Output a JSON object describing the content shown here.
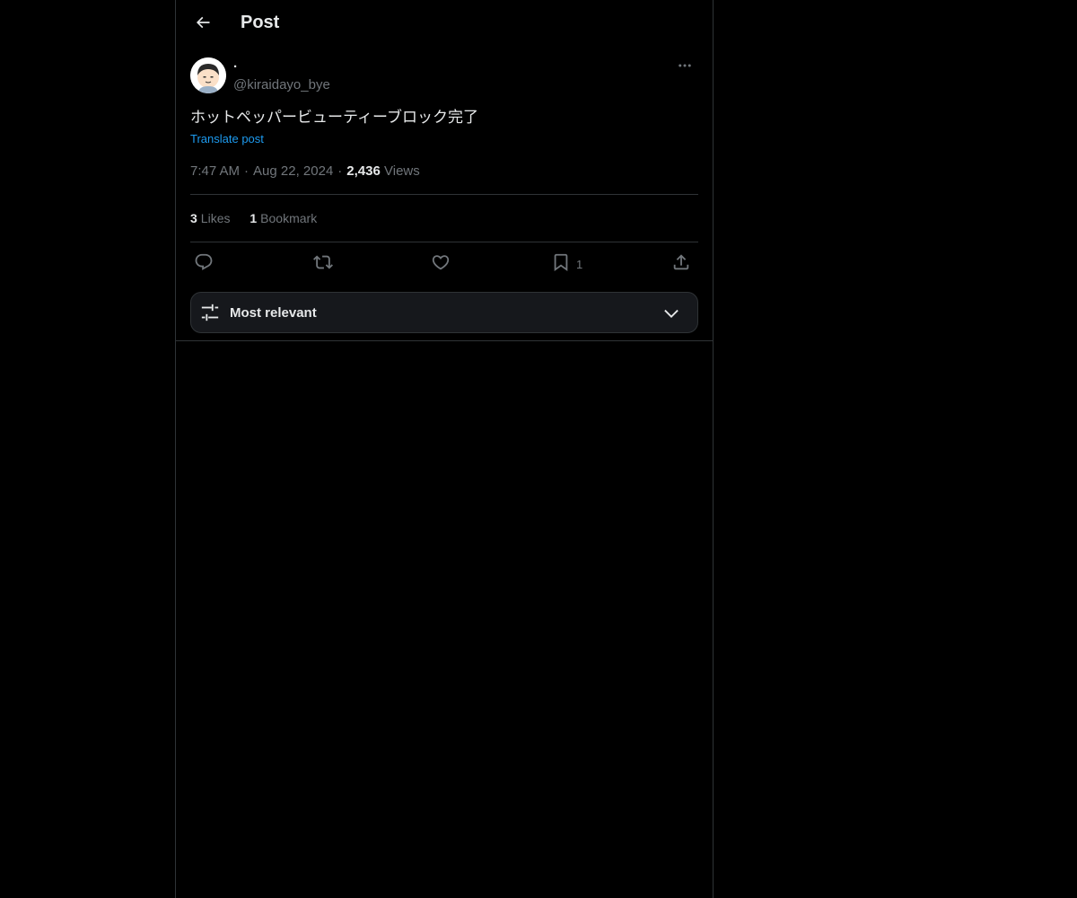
{
  "header": {
    "title": "Post",
    "back_icon": "arrow-left-icon"
  },
  "post": {
    "author": {
      "display_name": "·",
      "handle": "@kiraidayo_bye",
      "avatar_icon": "avatar-illustration"
    },
    "text": "ホットペッパービューティーブロック完了",
    "translate_label": "Translate post",
    "time": "7:47 AM",
    "date": "Aug 22, 2024",
    "views_count": "2,436",
    "views_label": "Views",
    "separator": "·"
  },
  "stats": {
    "likes_count": "3",
    "likes_label": "Likes",
    "bookmarks_count": "1",
    "bookmarks_label": "Bookmark"
  },
  "actions": {
    "reply_icon": "reply-icon",
    "repost_icon": "repost-icon",
    "like_icon": "heart-icon",
    "bookmark_icon": "bookmark-icon",
    "bookmark_count": "1",
    "share_icon": "share-icon"
  },
  "sort": {
    "label": "Most relevant",
    "icon": "sliders-icon",
    "chevron": "chevron-down-icon"
  },
  "colors": {
    "background": "#000000",
    "text_primary": "#e7e9ea",
    "text_secondary": "#71767b",
    "link": "#1d9bf0",
    "border": "#2f3336"
  }
}
